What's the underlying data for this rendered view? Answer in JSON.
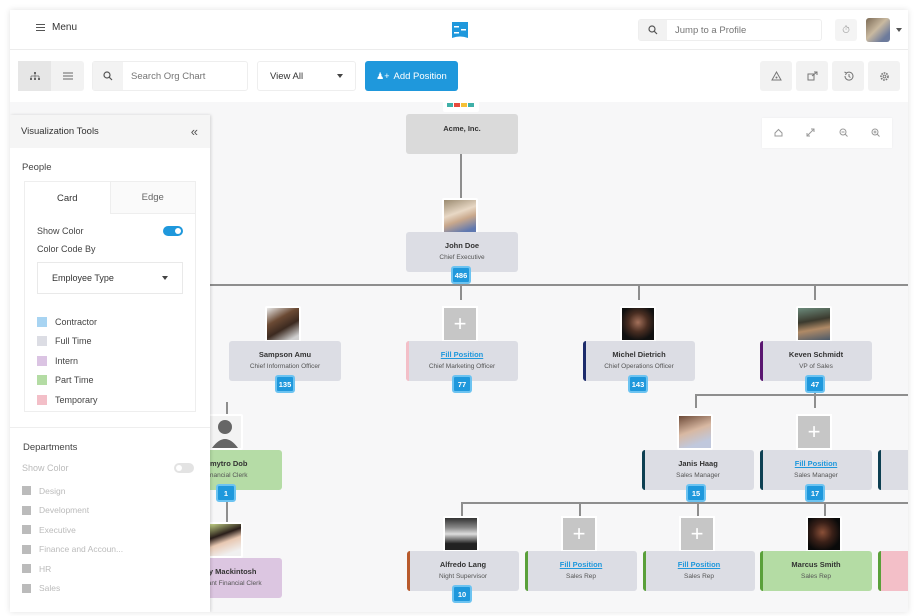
{
  "topbar": {
    "menu_label": "Menu",
    "jump_placeholder": "Jump to a Profile",
    "brand_color": "#1f98dc"
  },
  "toolbar": {
    "search_placeholder": "Search Org Chart",
    "view_selected": "View All",
    "add_position_label": "Add Position",
    "right_icons": [
      "org-export-icon",
      "share-icon",
      "history-icon",
      "settings-icon"
    ]
  },
  "zoom_tools": [
    "home-icon",
    "fit-expand-icon",
    "zoom-out-icon",
    "zoom-in-icon"
  ],
  "side_panel": {
    "title": "Visualization Tools",
    "people_label": "People",
    "tabs": [
      "Card",
      "Edge"
    ],
    "show_color_label": "Show Color",
    "show_color_on": true,
    "color_code_by_label": "Color Code By",
    "color_code_by_value": "Employee Type",
    "legend": [
      {
        "label": "Contractor",
        "color": "#a8d4f2"
      },
      {
        "label": "Full Time",
        "color": "#dcdde4"
      },
      {
        "label": "Intern",
        "color": "#dbc4e3"
      },
      {
        "label": "Part Time",
        "color": "#b4dca4"
      },
      {
        "label": "Temporary",
        "color": "#f3bfc8"
      }
    ],
    "departments": {
      "title": "Departments",
      "show_color_label": "Show Color",
      "show_color_on": false,
      "items": [
        "Design",
        "Development",
        "Executive",
        "Finance and Accoun...",
        "HR",
        "Sales"
      ]
    }
  },
  "org": {
    "root": {
      "name": "Acme, Inc."
    },
    "ceo": {
      "name": "John Doe",
      "title": "Chief Executive",
      "count": "486"
    },
    "level2": [
      {
        "name": "Sampson Amu",
        "title": "Chief Information Officer",
        "count": "135"
      },
      {
        "name": "Fill Position",
        "title": "Chief Marketing Officer",
        "count": "77",
        "vacant": true
      },
      {
        "name": "Michel Dietrich",
        "title": "Chief Operations Officer",
        "count": "143"
      },
      {
        "name": "Keven Schmidt",
        "title": "VP of Sales",
        "count": "47"
      }
    ],
    "finance": [
      {
        "name": "Dmytro Dob",
        "title": "Financial Clerk",
        "count": "1"
      },
      {
        "name": "Mary Mackintosh",
        "title": "Assistant Financial Clerk"
      }
    ],
    "sales_managers": [
      {
        "name": "Janis Haag",
        "title": "Sales Manager",
        "count": "15"
      },
      {
        "name": "Fill Position",
        "title": "Sales Manager",
        "count": "17",
        "vacant": true
      }
    ],
    "reps": [
      {
        "name": "Alfredo Lang",
        "title": "Night Supervisor",
        "count": "10"
      },
      {
        "name": "Fill Position",
        "title": "Sales Rep",
        "vacant": true
      },
      {
        "name": "Fill Position",
        "title": "Sales Rep",
        "vacant": true
      },
      {
        "name": "Marcus Smith",
        "title": "Sales Rep"
      }
    ]
  }
}
